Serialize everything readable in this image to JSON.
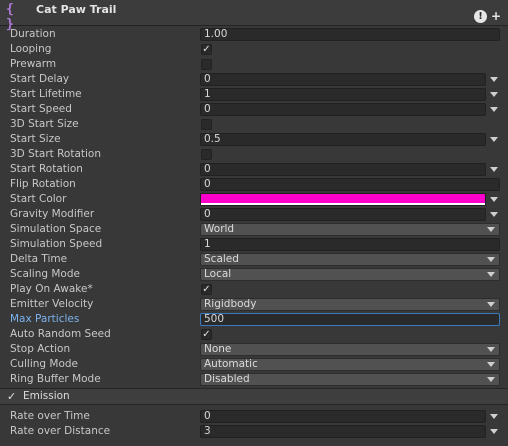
{
  "header": {
    "icon": "particle-module-icon",
    "icon_glyph": "{ }",
    "title": "Cat Paw Trail",
    "info_glyph": "!",
    "add_glyph": "+"
  },
  "rows": {
    "duration": {
      "label": "Duration",
      "value": "1.00"
    },
    "looping": {
      "label": "Looping",
      "checked": true
    },
    "prewarm": {
      "label": "Prewarm",
      "checked": false
    },
    "start_delay": {
      "label": "Start Delay",
      "value": "0"
    },
    "start_lifetime": {
      "label": "Start Lifetime",
      "value": "1"
    },
    "start_speed": {
      "label": "Start Speed",
      "value": "0"
    },
    "start_size_3d": {
      "label": "3D Start Size",
      "checked": false
    },
    "start_size": {
      "label": "Start Size",
      "value": "0.5"
    },
    "start_rotation_3d": {
      "label": "3D Start Rotation",
      "checked": false
    },
    "start_rotation": {
      "label": "Start Rotation",
      "value": "0"
    },
    "flip_rotation": {
      "label": "Flip Rotation",
      "value": "0"
    },
    "start_color": {
      "label": "Start Color",
      "color": "#ff00cc"
    },
    "gravity_modifier": {
      "label": "Gravity Modifier",
      "value": "0"
    },
    "simulation_space": {
      "label": "Simulation Space",
      "value": "World"
    },
    "simulation_speed": {
      "label": "Simulation Speed",
      "value": "1"
    },
    "delta_time": {
      "label": "Delta Time",
      "value": "Scaled"
    },
    "scaling_mode": {
      "label": "Scaling Mode",
      "value": "Local"
    },
    "play_on_awake": {
      "label": "Play On Awake*",
      "checked": true
    },
    "emitter_velocity": {
      "label": "Emitter Velocity",
      "value": "Rigidbody"
    },
    "max_particles": {
      "label": "Max Particles",
      "value": "500"
    },
    "auto_random_seed": {
      "label": "Auto Random Seed",
      "checked": true
    },
    "stop_action": {
      "label": "Stop Action",
      "value": "None"
    },
    "culling_mode": {
      "label": "Culling Mode",
      "value": "Automatic"
    },
    "ring_buffer_mode": {
      "label": "Ring Buffer Mode",
      "value": "Disabled"
    }
  },
  "emission": {
    "title": "Emission",
    "enabled": true,
    "rate_over_time": {
      "label": "Rate over Time",
      "value": "0"
    },
    "rate_over_distance": {
      "label": "Rate over Distance",
      "value": "3"
    }
  },
  "colors": {
    "background": "#383838",
    "field": "#2a2a2a",
    "dropdown": "#515151",
    "highlight_label": "#7bb3ee",
    "focus_border": "#3a79bb",
    "start_color": "#ff00cc"
  }
}
